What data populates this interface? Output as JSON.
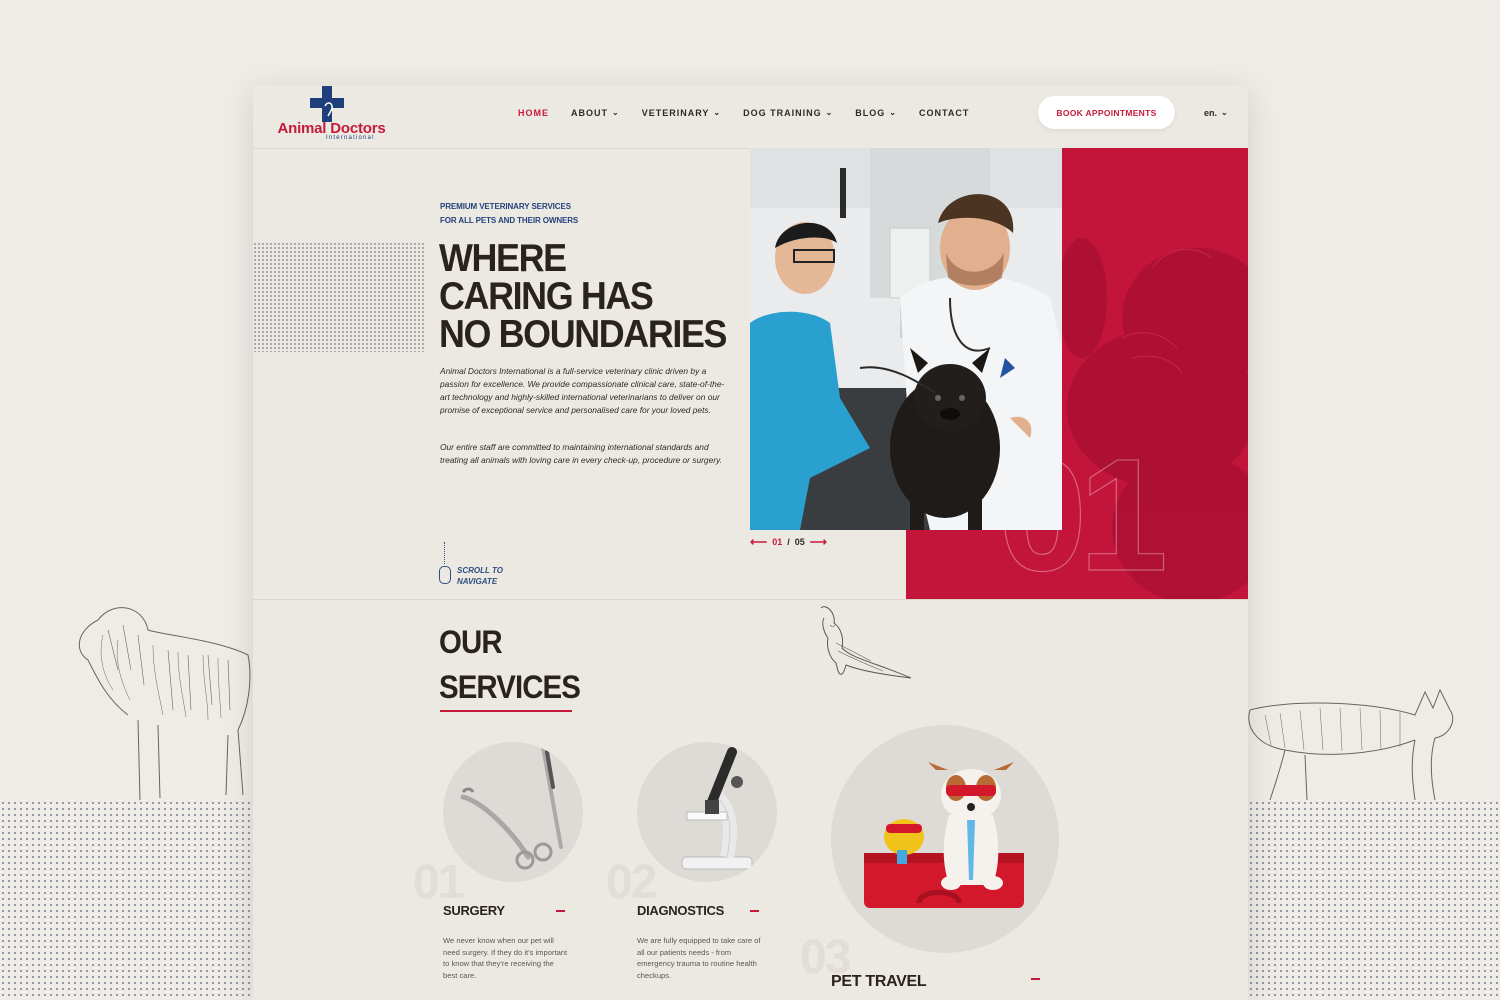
{
  "brand": {
    "name": "Animal Doctors",
    "subtitle": "International"
  },
  "nav": {
    "items": [
      {
        "label": "HOME",
        "active": true,
        "dropdown": false
      },
      {
        "label": "ABOUT",
        "active": false,
        "dropdown": true
      },
      {
        "label": "VETERINARY",
        "active": false,
        "dropdown": true
      },
      {
        "label": "DOG TRAINING",
        "active": false,
        "dropdown": true
      },
      {
        "label": "BLOG",
        "active": false,
        "dropdown": true
      },
      {
        "label": "CONTACT",
        "active": false,
        "dropdown": false
      }
    ],
    "cta": "BOOK APPOINTMENTS",
    "lang": "en."
  },
  "hero": {
    "kicker_line1": "PREMIUM VETERINARY SERVICES",
    "kicker_line2": "FOR ALL PETS AND THEIR OWNERS",
    "headline_line1": "WHERE",
    "headline_line2": "CARING HAS",
    "headline_line3": "NO BOUNDARIES",
    "paragraph1": "Animal Doctors International is a full-service veterinary clinic driven by a passion for excellence. We provide compassionate clinical care, state-of-the-art technology and highly-skilled international veterinarians to deliver on our promise of exceptional service and personalised care for your loved pets.",
    "paragraph2": "Our entire staff are committed to maintaining international standards and treating all animals with loving care in every check-up, procedure or surgery.",
    "slide_number": "01",
    "slide_current": "01",
    "slide_total": "05",
    "scroll_line1": "SCROLL TO",
    "scroll_line2": "NAVIGATE"
  },
  "services": {
    "title_line1": "OUR",
    "title_line2": "SERVICES",
    "items": [
      {
        "number": "01",
        "name": "SURGERY",
        "description": "We never know when our pet will need surgery. If they do it's important to know that they're receiving the best care."
      },
      {
        "number": "02",
        "name": "DIAGNOSTICS",
        "description": "We are fully equipped to take care of all our patients needs - from emergency trauma to routine health checkups."
      },
      {
        "number": "03",
        "name": "PET TRAVEL",
        "description": ""
      }
    ]
  },
  "colors": {
    "accent": "#c61a3a",
    "navy": "#24427c",
    "red_panel": "#c3143a",
    "page_bg": "#ece8e2"
  }
}
